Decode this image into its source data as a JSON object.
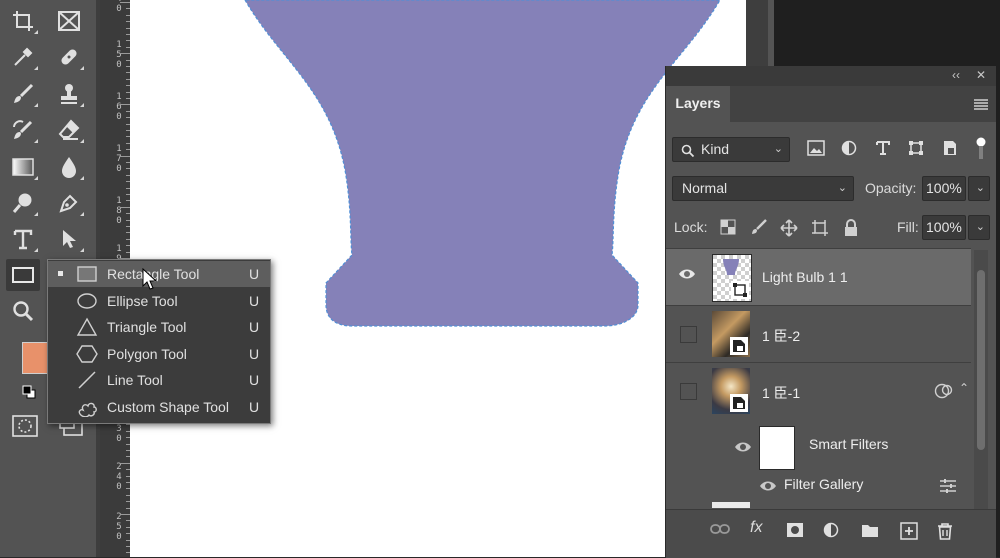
{
  "ruler": {
    "labels": [
      "4\n0",
      "1\n5\n0",
      "1\n6\n0",
      "1\n7\n0",
      "1\n8\n0",
      "1\n9",
      "3\n0",
      "2\n4\n0",
      "2\n5\n0"
    ]
  },
  "toolbar": {
    "tools": [
      "crop-icon",
      "frame-icon",
      "eyedropper-icon",
      "healing-brush-icon",
      "brush-icon",
      "clone-stamp-icon",
      "history-brush-icon",
      "eraser-icon",
      "gradient-icon",
      "blur-icon",
      "dodge-icon",
      "pen-icon",
      "type-icon",
      "path-selection-icon",
      "rectangle-icon",
      "zoom-icon"
    ],
    "foreground_color": "#e8916a"
  },
  "canvas": {
    "shape_color": "#8581b8",
    "outline_color": "#4f8fd6"
  },
  "flyout": {
    "items": [
      {
        "label": "Rectangle Tool",
        "key": "U",
        "icon": "rectangle-icon",
        "selected": true
      },
      {
        "label": "Ellipse Tool",
        "key": "U",
        "icon": "ellipse-icon",
        "selected": false
      },
      {
        "label": "Triangle Tool",
        "key": "U",
        "icon": "triangle-icon",
        "selected": false
      },
      {
        "label": "Polygon Tool",
        "key": "U",
        "icon": "polygon-icon",
        "selected": false
      },
      {
        "label": "Line Tool",
        "key": "U",
        "icon": "line-icon",
        "selected": false
      },
      {
        "label": "Custom Shape Tool",
        "key": "U",
        "icon": "custom-shape-icon",
        "selected": false
      }
    ]
  },
  "layers_panel": {
    "collapse": "‹‹",
    "close": "✕",
    "tab": "Layers",
    "filter": {
      "label": "Kind"
    },
    "blend_mode": "Normal",
    "opacity_label": "Opacity:",
    "opacity_value": "100%",
    "lock_label": "Lock:",
    "fill_label": "Fill:",
    "fill_value": "100%",
    "layers": [
      {
        "name": "Light Bulb 1 1",
        "visible": true,
        "selected": true
      },
      {
        "name": "1 ⾂-2",
        "visible": false,
        "selected": false
      },
      {
        "name": "1 ⾂-1",
        "visible": false,
        "selected": false
      }
    ],
    "smart_filters_label": "Smart Filters",
    "filter_gallery_label": "Filter Gallery"
  }
}
